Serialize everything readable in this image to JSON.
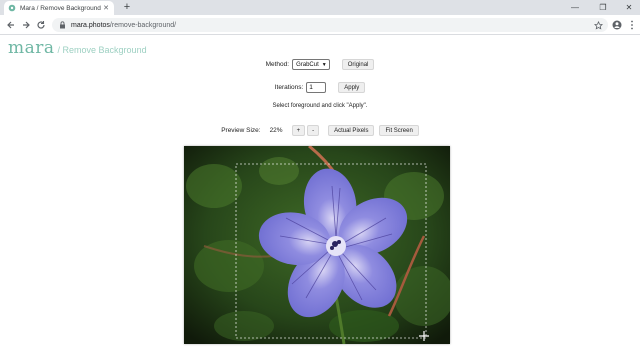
{
  "browser": {
    "tab_title": "Mara / Remove Background",
    "url_host": "mara.photos",
    "url_path": "/remove-background/"
  },
  "brand": {
    "logo": "mara",
    "subtitle": "/ Remove Background"
  },
  "controls": {
    "method_label": "Method:",
    "method_value": "GrabCut",
    "original_button": "Original",
    "iterations_label": "Iterations:",
    "iterations_value": "1",
    "apply_button": "Apply",
    "instruction": "Select foreground and click \"Apply\".",
    "preview_size_label": "Preview Size:",
    "preview_size_value": "22%",
    "zoom_in": "+",
    "zoom_out": "-",
    "actual_pixels_button": "Actual Pixels",
    "fit_screen_button": "Fit Screen"
  },
  "colors": {
    "brand": "#6fb7a4",
    "flower_petal": "#7e7ed8",
    "foliage": "#2e5a1c"
  }
}
